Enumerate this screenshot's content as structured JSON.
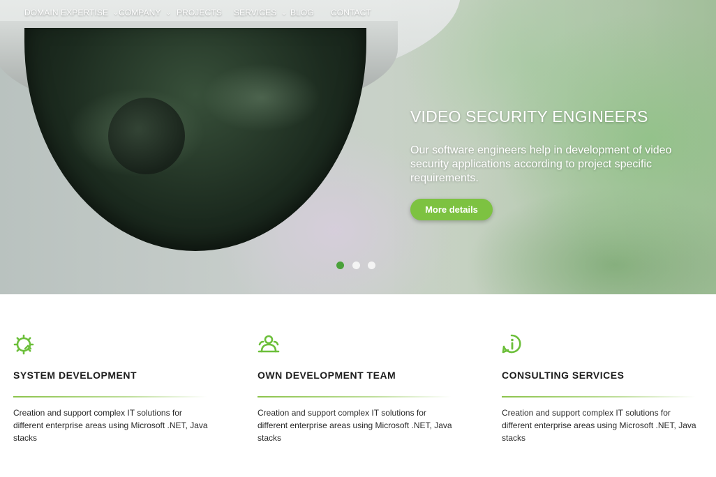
{
  "nav": {
    "items": [
      {
        "label": "DOMAIN EXPERTISE",
        "has_dropdown": true
      },
      {
        "label": "COMPANY",
        "has_dropdown": true
      },
      {
        "label": "PROJECTS",
        "has_dropdown": false
      },
      {
        "label": "SERVICES",
        "has_dropdown": true
      },
      {
        "label": "BLOG",
        "has_dropdown": false
      },
      {
        "label": "CONTACT",
        "has_dropdown": false
      }
    ],
    "chevron_icon": "chevron-down-icon"
  },
  "hero": {
    "title": "VIDEO SECURITY ENGINEERS",
    "description": "Our software engineers help in development of video security applications according to project specific requirements.",
    "button_label": "More details",
    "slides_total": 3,
    "active_slide": 1,
    "accent_color": "#7dc241",
    "active_dot_color": "#4aa13a"
  },
  "features": [
    {
      "icon": "gear-code-icon",
      "title": "SYSTEM DEVELOPMENT",
      "description": "Creation and support complex IT solutions for different enterprise areas using Microsoft .NET, Java stacks"
    },
    {
      "icon": "team-icon",
      "title": "OWN DEVELOPMENT TEAM",
      "description": "Creation and support complex IT solutions for different enterprise areas using Microsoft .NET, Java stacks"
    },
    {
      "icon": "info-chat-icon",
      "title": "CONSULTING SERVICES",
      "description": "Creation and support complex IT solutions for different enterprise areas using Microsoft .NET, Java stacks"
    }
  ],
  "colors": {
    "brand_green": "#7dc241",
    "icon_green": "#6cbf3a",
    "text_dark": "#1d1d1d"
  }
}
